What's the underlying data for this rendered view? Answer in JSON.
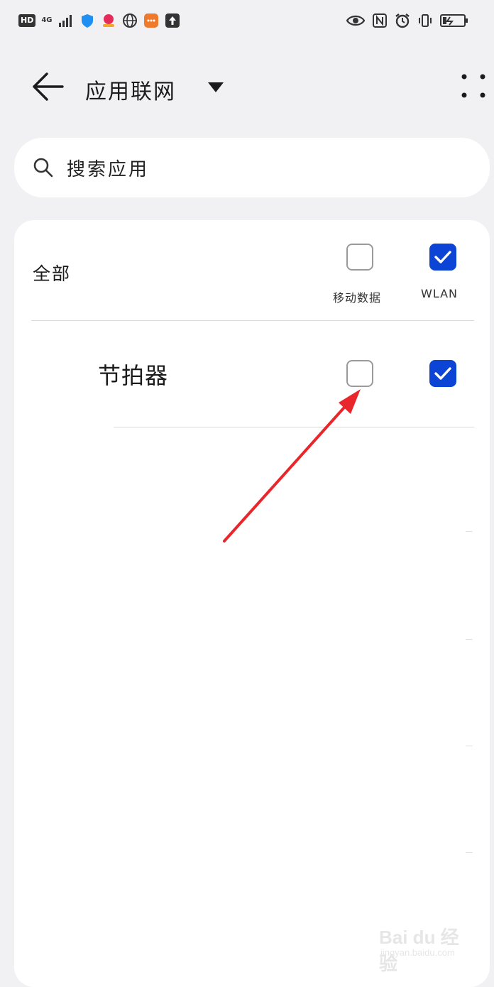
{
  "status_bar": {
    "hd": "HD",
    "network": "4G",
    "left_icons": [
      "signal-icon",
      "shield-icon",
      "app-icon",
      "globe-icon",
      "message-icon",
      "upload-icon"
    ],
    "right_icons": [
      "eye-icon",
      "nfc-icon",
      "alarm-icon",
      "vibrate-icon",
      "battery-icon"
    ]
  },
  "header": {
    "title": "应用联网",
    "back_icon": "arrow-left-icon",
    "dropdown_icon": "triangle-down-icon",
    "more_icon": "more-dots-icon"
  },
  "search": {
    "placeholder": "搜索应用"
  },
  "list": {
    "all_label": "全部",
    "col_mobile": "移动数据",
    "col_wlan": "WLAN",
    "all_mobile_checked": false,
    "all_wlan_checked": true,
    "apps": [
      {
        "name": "节拍器",
        "mobile_checked": false,
        "wlan_checked": true
      }
    ]
  },
  "colors": {
    "accent": "#0c44d6",
    "arrow": "#e8262b",
    "background": "#f1f1f3"
  },
  "watermark": {
    "brand": "Bai du 经验",
    "url": "jingyan.baidu.com"
  }
}
